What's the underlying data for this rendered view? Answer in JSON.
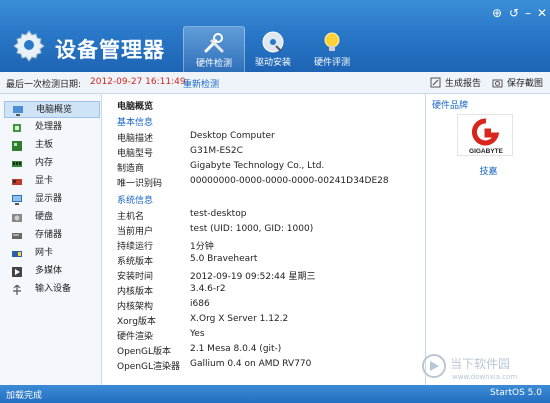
{
  "header": {
    "app_title": "设备管理器",
    "tabs": [
      {
        "label": "硬件检测"
      },
      {
        "label": "驱动安装"
      },
      {
        "label": "硬件评测"
      }
    ],
    "colors": {
      "header_top": "#3b8fd8",
      "header_bottom": "#1e64b4"
    }
  },
  "toolbar": {
    "last_check_label": "最后一次检测日期:",
    "last_check_value": "2012-09-27 16:11:49",
    "recheck_label": "重新检测",
    "report_label": "生成报告",
    "screenshot_label": "保存截图"
  },
  "sidebar": {
    "items": [
      {
        "label": "电脑概览",
        "icon": "monitor-icon"
      },
      {
        "label": "处理器",
        "icon": "cpu-icon"
      },
      {
        "label": "主板",
        "icon": "motherboard-icon"
      },
      {
        "label": "内存",
        "icon": "memory-icon"
      },
      {
        "label": "显卡",
        "icon": "graphics-card-icon"
      },
      {
        "label": "显示器",
        "icon": "display-icon"
      },
      {
        "label": "硬盘",
        "icon": "hard-disk-icon"
      },
      {
        "label": "存储器",
        "icon": "storage-icon"
      },
      {
        "label": "网卡",
        "icon": "network-card-icon"
      },
      {
        "label": "多媒体",
        "icon": "multimedia-icon"
      },
      {
        "label": "输入设备",
        "icon": "input-device-icon"
      }
    ]
  },
  "main": {
    "title": "电脑概览",
    "basic_title": "基本信息",
    "basic_rows": [
      {
        "k": "电脑描述",
        "v": "Desktop Computer"
      },
      {
        "k": "电脑型号",
        "v": "G31M-ES2C"
      },
      {
        "k": "制造商",
        "v": "Gigabyte Technology Co., Ltd."
      },
      {
        "k": "唯一识别码",
        "v": "00000000-0000-0000-0000-00241D34DE28"
      }
    ],
    "system_title": "系统信息",
    "system_rows": [
      {
        "k": "主机名",
        "v": "test-desktop"
      },
      {
        "k": "当前用户",
        "v": "test (UID: 1000, GID: 1000)"
      },
      {
        "k": "持续运行",
        "v": "1分钟"
      },
      {
        "k": "系统版本",
        "v": "5.0 Braveheart"
      },
      {
        "k": "安装时间",
        "v": "2012-09-19 09:52:44 星期三"
      },
      {
        "k": "内核版本",
        "v": "3.4.6-r2"
      },
      {
        "k": "内核架构",
        "v": "i686"
      },
      {
        "k": "Xorg版本",
        "v": "X.Org X Server 1.12.2"
      },
      {
        "k": "硬件渲染",
        "v": "Yes"
      },
      {
        "k": "OpenGL版本",
        "v": "2.1 Mesa 8.0.4 (git-)"
      },
      {
        "k": "OpenGL渲染器",
        "v": "Gallium 0.4 on AMD RV770"
      }
    ]
  },
  "right_panel": {
    "title": "硬件品牌",
    "brand_logo_text": "GIGABYTE",
    "brand_name": "技嘉"
  },
  "status": {
    "left": "加载完成",
    "right": "StartOS 5.0"
  },
  "watermark": {
    "text": "当下软件园",
    "sub": "www.downxia.com"
  }
}
